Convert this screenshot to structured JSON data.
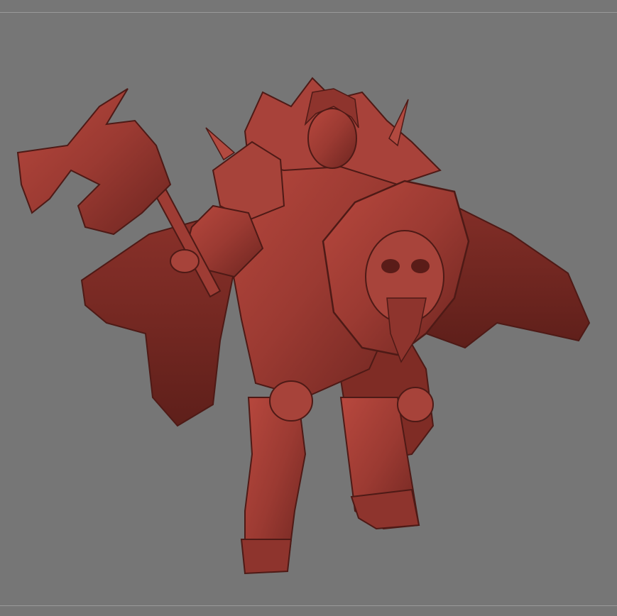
{
  "viewport": {
    "background_color": "#767676",
    "frame_line_color": "#9a9a9a",
    "model_material_color": "#9b3a32",
    "model_shadow_color": "#5e1f1a",
    "model_highlight_color": "#c4584c"
  },
  "scene": {
    "subject_icon": "sculpt-model-icon"
  }
}
